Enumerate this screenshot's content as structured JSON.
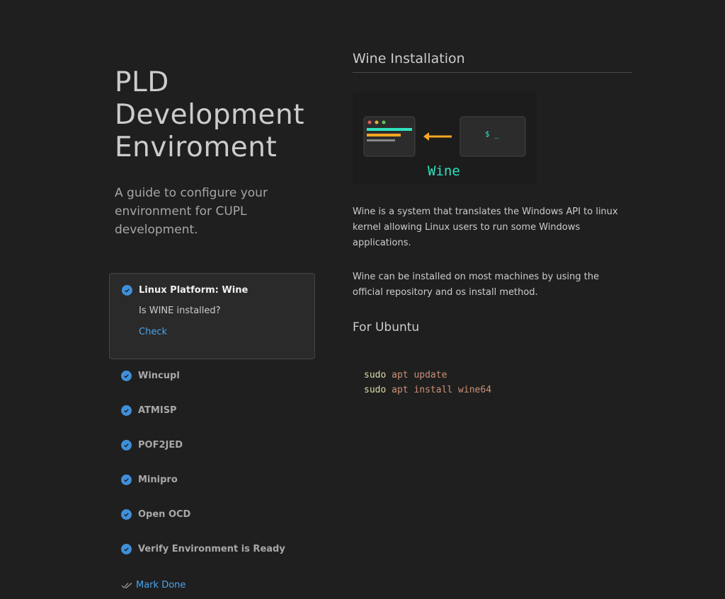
{
  "header": {
    "title": "PLD Development Enviroment",
    "subtitle": "A guide to configure your environment for CUPL development."
  },
  "steps": {
    "active": {
      "title": "Linux Platform: Wine",
      "description": "Is WINE installed?",
      "link_label": "Check"
    },
    "items": [
      {
        "label": "Wincupl"
      },
      {
        "label": "ATMISP"
      },
      {
        "label": "POF2JED"
      },
      {
        "label": "Minipro"
      },
      {
        "label": "Open OCD"
      },
      {
        "label": "Verify Environment is Ready"
      }
    ],
    "mark_done_label": "Mark Done",
    "check_icon": "circle-check-icon",
    "mark_done_icon": "double-check-icon"
  },
  "content": {
    "title": "Wine Installation",
    "illustration": {
      "caption": "Wine",
      "terminal_prompt": "$ _"
    },
    "paragraphs": [
      "Wine is a system that translates the Windows API to linux kernel allowing Linux users to run some Windows applications.",
      "Wine can be installed on most machines by using the official repository and os install method."
    ],
    "subheading": "For Ubuntu",
    "code_lines": [
      {
        "cmd": "sudo",
        "args": " apt update"
      },
      {
        "cmd": "sudo",
        "args": " apt install wine64"
      }
    ]
  },
  "colors": {
    "background": "#1f1f1f",
    "accent": "#4da3ee",
    "check": "#3f8fd9",
    "illustration_caption": "#2fe3c0",
    "arrow": "#f5a623"
  }
}
